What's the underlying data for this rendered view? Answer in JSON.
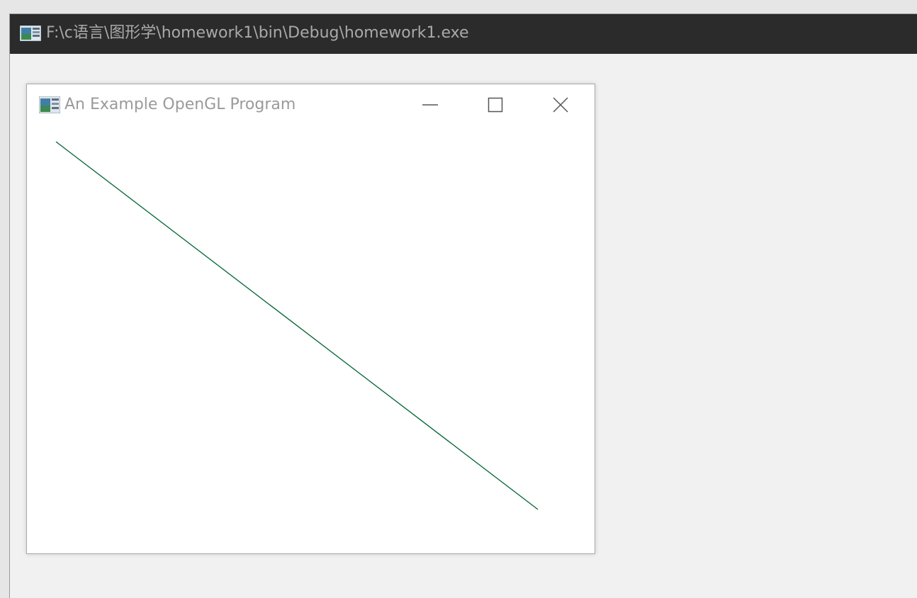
{
  "console_window": {
    "title": "F:\\c语言\\图形学\\homework1\\bin\\Debug\\homework1.exe",
    "icon": "console-app-icon"
  },
  "gl_window": {
    "title": "An Example OpenGL Program",
    "icon": "app-icon",
    "controls": {
      "minimize": "minimize-icon",
      "maximize": "maximize-icon",
      "close": "close-icon"
    },
    "line_color": "#006633"
  }
}
